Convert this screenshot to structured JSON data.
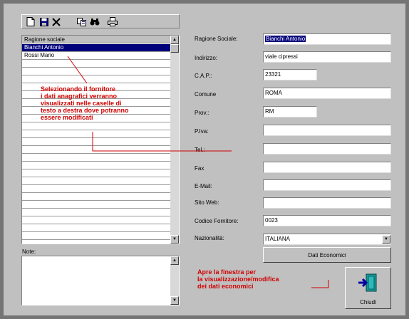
{
  "toolbar": {
    "icons": [
      "new-icon",
      "save-icon",
      "delete-icon",
      "copy-icon",
      "find-icon",
      "print-icon"
    ]
  },
  "list": {
    "header": "Ragione sociale",
    "rows": [
      "Bianchi Antonio",
      "Rossi Mario"
    ],
    "selected_index": 0
  },
  "note": {
    "label": "Note:"
  },
  "form": {
    "ragione_sociale": {
      "label": "Ragione Sociale:",
      "value": "Bianchi Antonio"
    },
    "indirizzo": {
      "label": "Indirizzo:",
      "value": "viale cipressi"
    },
    "cap": {
      "label": "C.A.P.:",
      "value": "23321"
    },
    "comune": {
      "label": "Comune",
      "value": "ROMA"
    },
    "prov": {
      "label": "Prov.:",
      "value": "RM"
    },
    "piva": {
      "label": "P.Iva:",
      "value": ""
    },
    "tel": {
      "label": "Tel.:",
      "value": ""
    },
    "fax": {
      "label": "Fax",
      "value": ""
    },
    "email": {
      "label": "E-Mail:",
      "value": ""
    },
    "sito_web": {
      "label": "Sito Web:",
      "value": ""
    },
    "codice_fornitore": {
      "label": "Codice Fornitore:",
      "value": "0023"
    },
    "nazionalita": {
      "label": "Nazionalità:",
      "value": "ITALIANA"
    }
  },
  "buttons": {
    "dati_economici": "Dati Economici",
    "chiudi": "Chiudi"
  },
  "annotations": {
    "list_hint": [
      "Selezionando il fornitore",
      "i dati anagrafici verranno",
      "visualizzati nelle caselle di",
      "testo a destra dove potranno",
      "essere modificati"
    ],
    "button_hint": [
      "Apre la finestra per",
      "la visualizzazione/modifica",
      "dei dati economici"
    ]
  },
  "colors": {
    "background": "#c0c0c0",
    "selection": "#00007b",
    "annotation": "#d00000"
  }
}
